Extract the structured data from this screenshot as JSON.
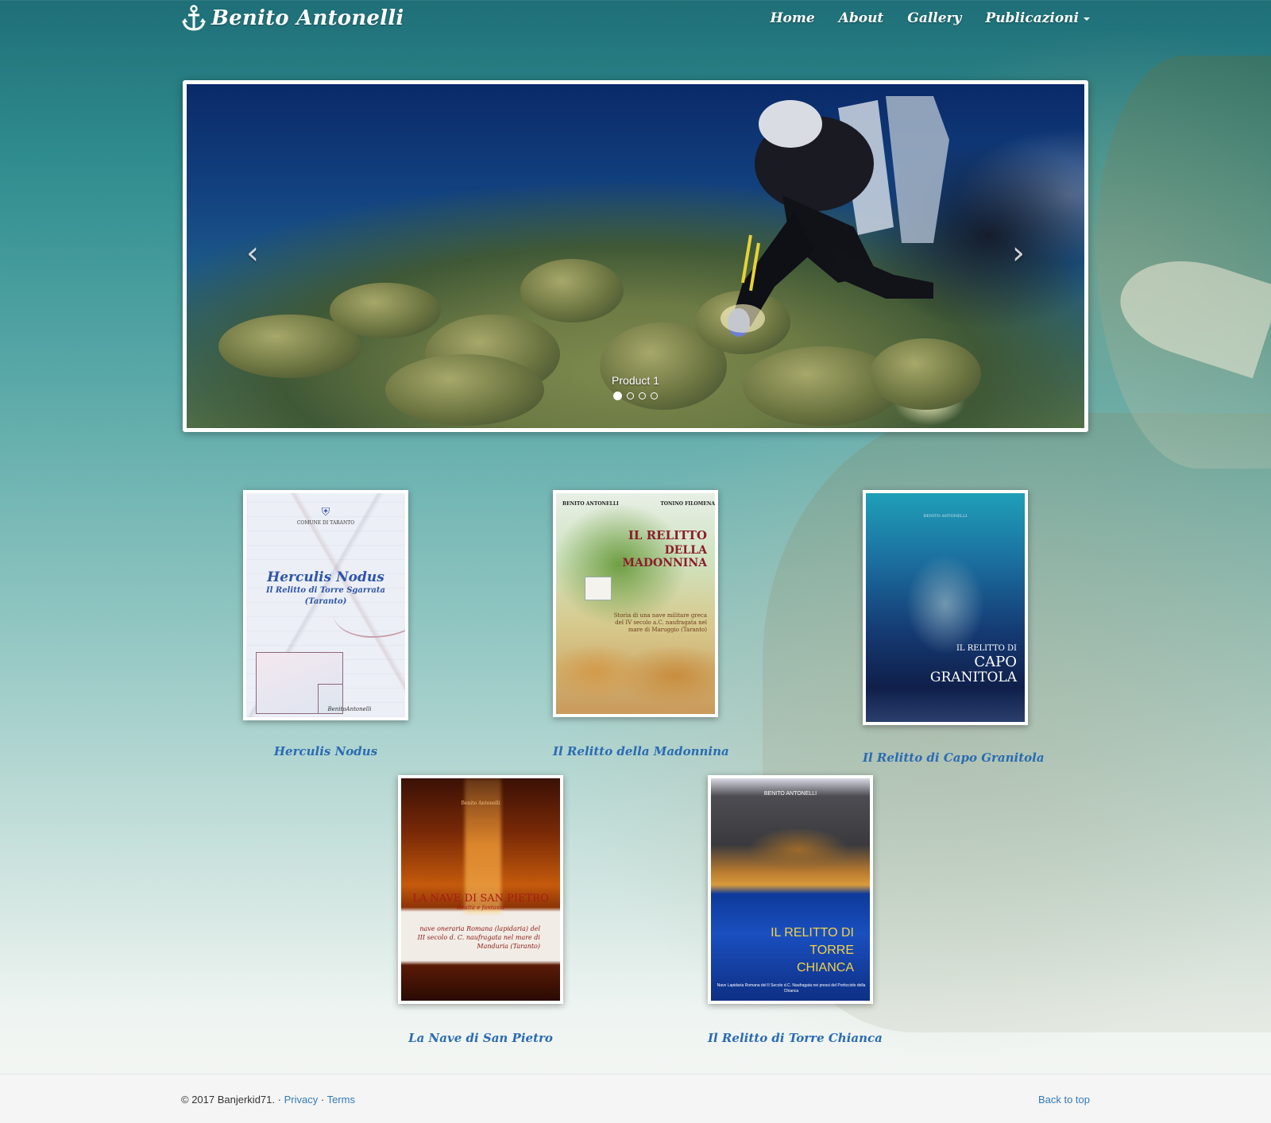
{
  "brand": {
    "name": "Benito Antonelli",
    "icon": "anchor-icon"
  },
  "nav": {
    "items": [
      {
        "label": "Home"
      },
      {
        "label": "About"
      },
      {
        "label": "Gallery"
      },
      {
        "label": "Publicazioni"
      }
    ]
  },
  "carousel": {
    "caption": "Product 1",
    "prev_icon": "chevron-left-icon",
    "next_icon": "chevron-right-icon",
    "prev_glyph": "‹",
    "next_glyph": "›",
    "slide_count": 4,
    "active_index": 0
  },
  "books": [
    {
      "title": "Herculis Nodus",
      "cover": {
        "line1": "COMUNE DI TARANTO",
        "main": "Herculis Nodus",
        "sub1": "Il Relitto di Torre Sgarrata",
        "sub2": "(Taranto)",
        "author": "BenitoAntonelli"
      }
    },
    {
      "title": "Il Relitto della Madonnina",
      "cover": {
        "author1": "BENITO ANTONELLI",
        "author2": "TONINO FILOMENA",
        "main1": "IL RELITTO",
        "main2": "DELLA MADONNINA",
        "desc": "Storia di una nave militare greca del IV secolo a.C. naufragata nel mare di Maruggio (Taranto)"
      }
    },
    {
      "title": "Il Relitto di Capo Granitola",
      "cover": {
        "author": "BENITO ANTONELLI",
        "main1": "IL RELITTO DI",
        "main2": "CAPO",
        "main3": "GRANITOLA"
      }
    },
    {
      "title": "La Nave di San Pietro",
      "cover": {
        "author": "Benito Antonelli",
        "main": "LA NAVE DI SAN PIETRO",
        "sub": "-Realtà e fantasia-",
        "desc": "nave oneraria Romana (lapidaria) del III secolo d. C. naufragata nel mare di Manduria (Taranto)"
      }
    },
    {
      "title": "Il Relitto di Torre Chianca",
      "cover": {
        "author": "BENITO ANTONELLI",
        "main1": "IL RELITTO DI",
        "main2": "TORRE",
        "main3": "CHIANCA",
        "desc": "Nave Lapidaria Romana del II Secolo d.C. Naufragata nei pressi del Porticciolo della Chianca"
      }
    }
  ],
  "footer": {
    "copyright": "© 2017 Banjerkid71.",
    "sep": "·",
    "privacy": "Privacy",
    "terms": "Terms",
    "back_to_top": "Back to top"
  }
}
